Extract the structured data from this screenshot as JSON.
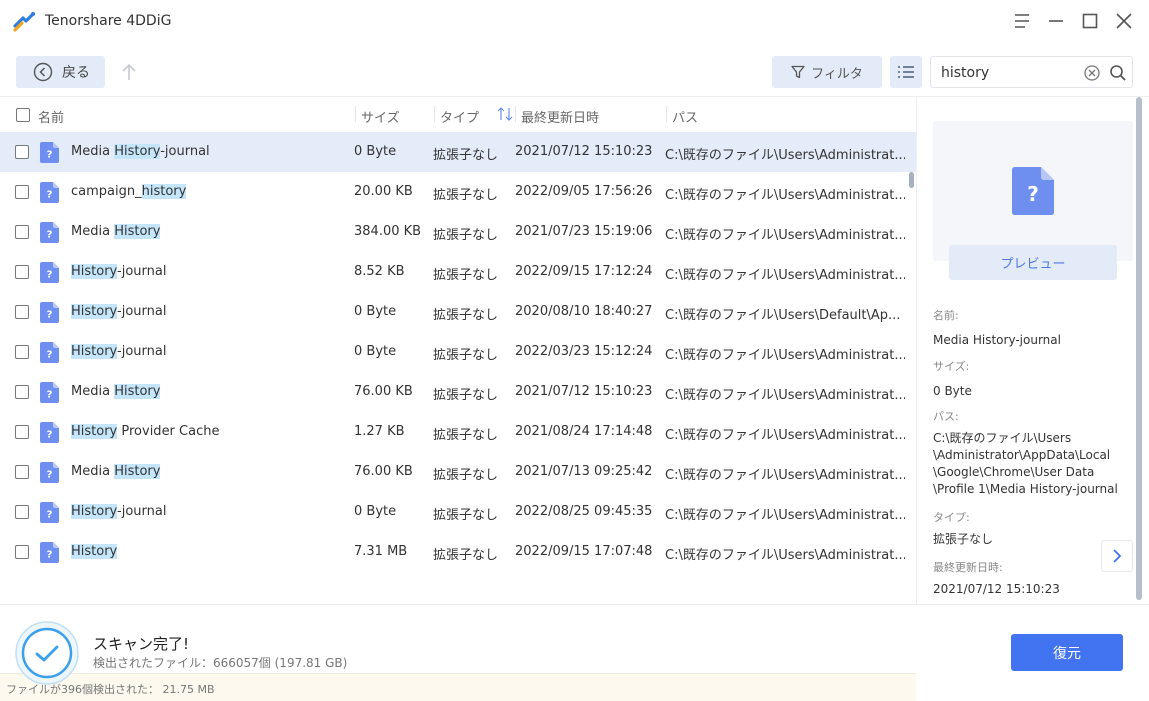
{
  "app": {
    "title": "Tenorshare 4DDiG"
  },
  "toolbar": {
    "back_label": "戻る",
    "filter_label": "フィルタ",
    "search_value": "history",
    "search_placeholder": ""
  },
  "table": {
    "columns": [
      "名前",
      "サイズ",
      "タイプ",
      "最終更新日時",
      "パス"
    ],
    "sort_icon": "sort-arrows-icon",
    "rows": [
      {
        "pre": "Media ",
        "hl": "History",
        "post": "-journal",
        "size": "0 Byte",
        "type": "拡張子なし",
        "date": "2021/07/12 15:10:23",
        "path": "C:\\既存のファイル\\Users\\Administrat...",
        "selected": true
      },
      {
        "pre": "campaign_",
        "hl": "history",
        "post": "",
        "size": "20.00 KB",
        "type": "拡張子なし",
        "date": "2022/09/05 17:56:26",
        "path": "C:\\既存のファイル\\Users\\Administrat..."
      },
      {
        "pre": "Media ",
        "hl": "History",
        "post": "",
        "size": "384.00 KB",
        "type": "拡張子なし",
        "date": "2021/07/23 15:19:06",
        "path": "C:\\既存のファイル\\Users\\Administrat..."
      },
      {
        "pre": "",
        "hl": "History",
        "post": "-journal",
        "size": "8.52 KB",
        "type": "拡張子なし",
        "date": "2022/09/15 17:12:24",
        "path": "C:\\既存のファイル\\Users\\Administrat..."
      },
      {
        "pre": "",
        "hl": "History",
        "post": "-journal",
        "size": "0 Byte",
        "type": "拡張子なし",
        "date": "2020/08/10 18:40:27",
        "path": "C:\\既存のファイル\\Users\\Default\\Ap..."
      },
      {
        "pre": "",
        "hl": "History",
        "post": "-journal",
        "size": "0 Byte",
        "type": "拡張子なし",
        "date": "2022/03/23 15:12:24",
        "path": "C:\\既存のファイル\\Users\\Administrat..."
      },
      {
        "pre": "Media ",
        "hl": "History",
        "post": "",
        "size": "76.00 KB",
        "type": "拡張子なし",
        "date": "2021/07/12 15:10:23",
        "path": "C:\\既存のファイル\\Users\\Administrat..."
      },
      {
        "pre": "",
        "hl": "History",
        "post": " Provider Cache",
        "size": "1.27 KB",
        "type": "拡張子なし",
        "date": "2021/08/24 17:14:48",
        "path": "C:\\既存のファイル\\Users\\Administrat..."
      },
      {
        "pre": "Media ",
        "hl": "History",
        "post": "",
        "size": "76.00 KB",
        "type": "拡張子なし",
        "date": "2021/07/13 09:25:42",
        "path": "C:\\既存のファイル\\Users\\Administrat..."
      },
      {
        "pre": "",
        "hl": "History",
        "post": "-journal",
        "size": "0 Byte",
        "type": "拡張子なし",
        "date": "2022/08/25 09:45:35",
        "path": "C:\\既存のファイル\\Users\\Administrat..."
      },
      {
        "pre": "",
        "hl": "History",
        "post": "",
        "size": "7.31 MB",
        "type": "拡張子なし",
        "date": "2022/09/15 17:07:48",
        "path": "C:\\既存のファイル\\Users\\Administrat..."
      }
    ]
  },
  "found_summary": "ファイルが396個検出された：  21.75 MB",
  "preview": {
    "button_label": "プレビュー",
    "name_label": "名前:",
    "name_value": "Media History-journal",
    "size_label": "サイズ:",
    "size_value": "0 Byte",
    "path_label": "パス:",
    "path_lines": [
      "C:\\既存のファイル\\Users",
      "\\Administrator\\AppData\\Local",
      "\\Google\\Chrome\\User Data",
      "\\Profile 1\\Media History-journal"
    ],
    "type_label": "タイプ:",
    "type_value": "拡張子なし",
    "modified_label": "最終更新日時:",
    "modified_value": "2021/07/12 15:10:23"
  },
  "status": {
    "title": "スキャン完了!",
    "subtitle": "検出されたファイル：666057個 (197.81 GB)",
    "recover_label": "復元"
  },
  "colors": {
    "accent": "#4273f1",
    "highlight": "#c5e6fa",
    "selected_row": "#e4ebf9",
    "file_icon": "#6f8ff0"
  }
}
